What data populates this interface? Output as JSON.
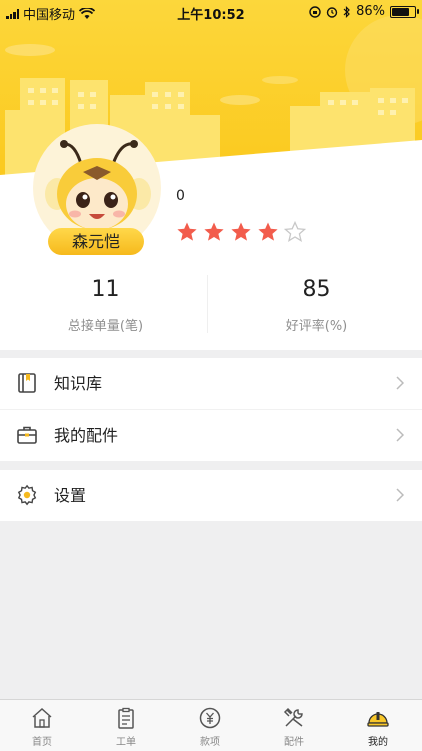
{
  "status_bar": {
    "carrier": "中国移动",
    "time": "上午10:52",
    "battery": "86%",
    "battery_level": 0.86
  },
  "profile": {
    "name": "森元恺",
    "score": "0",
    "rating_stars": 4,
    "rating_max": 5
  },
  "stats": [
    {
      "value": "11",
      "label": "总接单量(笔)"
    },
    {
      "value": "85",
      "label": "好评率(%)"
    }
  ],
  "menu": {
    "group1": [
      {
        "label": "知识库",
        "icon": "book-icon"
      },
      {
        "label": "我的配件",
        "icon": "toolbox-icon"
      }
    ],
    "group2": [
      {
        "label": "设置",
        "icon": "gear-icon"
      }
    ]
  },
  "tabbar": [
    {
      "label": "首页",
      "icon": "home-icon",
      "active": false
    },
    {
      "label": "工单",
      "icon": "clipboard-icon",
      "active": false
    },
    {
      "label": "款项",
      "icon": "yuan-icon",
      "active": false
    },
    {
      "label": "配件",
      "icon": "tools-icon",
      "active": false
    },
    {
      "label": "我的",
      "icon": "helmet-icon",
      "active": true
    }
  ],
  "colors": {
    "header_yellow": "#fbd12e",
    "star_active": "#f25c4c",
    "star_inactive": "#c8c8c8",
    "badge_yellow": "#f8c72a"
  }
}
